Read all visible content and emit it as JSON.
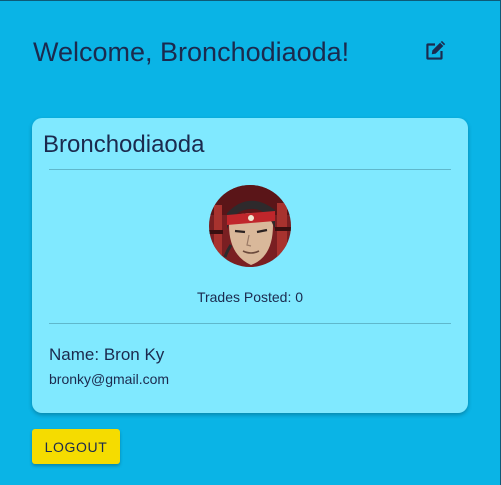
{
  "header": {
    "welcome_text": "Welcome, Bronchodiaoda!",
    "edit_icon": "edit-square-pencil-icon"
  },
  "profile_card": {
    "username": "Bronchodiaoda",
    "avatar": "avatar-image",
    "trades_label": "Trades Posted:",
    "trades_count": "0",
    "name_label": "Name:",
    "name_value": "Bron Ky",
    "email": "bronky@gmail.com"
  },
  "actions": {
    "logout_label": "LOGOUT"
  },
  "colors": {
    "background": "#0ab4e6",
    "card": "#80e9ff",
    "text": "#1b2a4e",
    "logout_button": "#f5dc00"
  }
}
